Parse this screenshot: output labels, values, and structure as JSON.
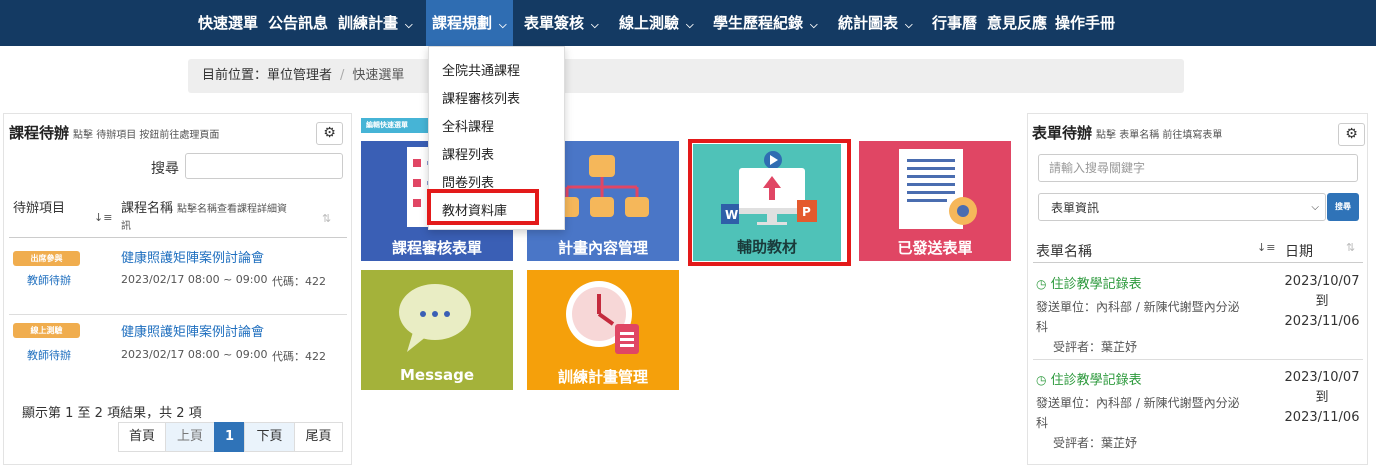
{
  "nav": {
    "items": [
      "快速選單",
      "公告訊息",
      "訓練計畫",
      "課程規劃",
      "表單簽核",
      "線上測驗",
      "學生歷程紀錄",
      "統計圖表",
      "行事曆",
      "意見反應",
      "操作手冊"
    ]
  },
  "breadcrumb": {
    "label": "目前位置：",
    "root": "單位管理者",
    "current": "快速選單"
  },
  "dropdown": {
    "items": [
      "全院共通課程",
      "課程審核列表",
      "全科課程",
      "課程列表",
      "問卷列表",
      "教材資料庫"
    ]
  },
  "left_panel": {
    "title": "課程待辦",
    "subtitle": "點擊 待辦項目 按鈕前往處理頁面",
    "search_label": "搜尋",
    "col_todo": "待辦項目",
    "col_course": "課程名稱",
    "col_course_hint_1": "點擊名稱查看課程詳細資",
    "col_course_hint_2": "訊",
    "rows": [
      {
        "badge": "出席參與",
        "sub": "教師待辦",
        "course": "健康照護矩陣案例討論會",
        "time": "2023/02/17 08:00 ~ 09:00",
        "code": "代碼：422",
        "badge_color": "#f0ad4e"
      },
      {
        "badge": "線上測驗",
        "sub": "教師待辦",
        "course": "健康照護矩陣案例討論會",
        "time": "2023/02/17 08:00 ~ 09:00",
        "code": "代碼：422",
        "badge_color": "#f0ad4e"
      }
    ],
    "info": "顯示第 1 至 2 項結果，共 2 項",
    "pager": {
      "first": "首頁",
      "prev": "上頁",
      "page": "1",
      "next": "下頁",
      "last": "尾頁"
    }
  },
  "quick_tag": "編輯快速選單",
  "tiles": [
    {
      "label": "課程審核表單",
      "color": "#3a5fb5",
      "icon": "checklist-icon"
    },
    {
      "label": "計畫內容管理",
      "color": "#4a76c7",
      "icon": "org-chart-icon"
    },
    {
      "label": "輔助教材",
      "color": "#4fc2b8",
      "icon": "monitor-upload-icon"
    },
    {
      "label": "已發送表單",
      "color": "#e04664",
      "icon": "document-gear-icon"
    },
    {
      "label": "Message",
      "color": "#a4b23a",
      "icon": "chat-bubble-icon"
    },
    {
      "label": "訓練計畫管理",
      "color": "#f5a00b",
      "icon": "clock-clipboard-icon"
    }
  ],
  "right_panel": {
    "title": "表單待辦",
    "subtitle": "點擊 表單名稱 前往填寫表單",
    "search_placeholder": "請輸入搜尋關鍵字",
    "select_value": "表單資訊",
    "search_btn": "搜尋",
    "col_name": "表單名稱",
    "col_date": "日期",
    "rows": [
      {
        "title": "住診教學記錄表",
        "dept_1": "發送單位：內科部 / 新陳代謝暨內分泌",
        "dept_2": "科",
        "reviewee": "受評者：葉芷妤",
        "date_from": "2023/10/07",
        "to": "到",
        "date_to": "2023/11/06"
      },
      {
        "title": "住診教學記錄表",
        "dept_1": "發送單位：內科部 / 新陳代謝暨內分泌",
        "dept_2": "科",
        "reviewee": "受評者：葉芷妤",
        "date_from": "2023/10/07",
        "to": "到",
        "date_to": "2023/11/06"
      }
    ]
  }
}
